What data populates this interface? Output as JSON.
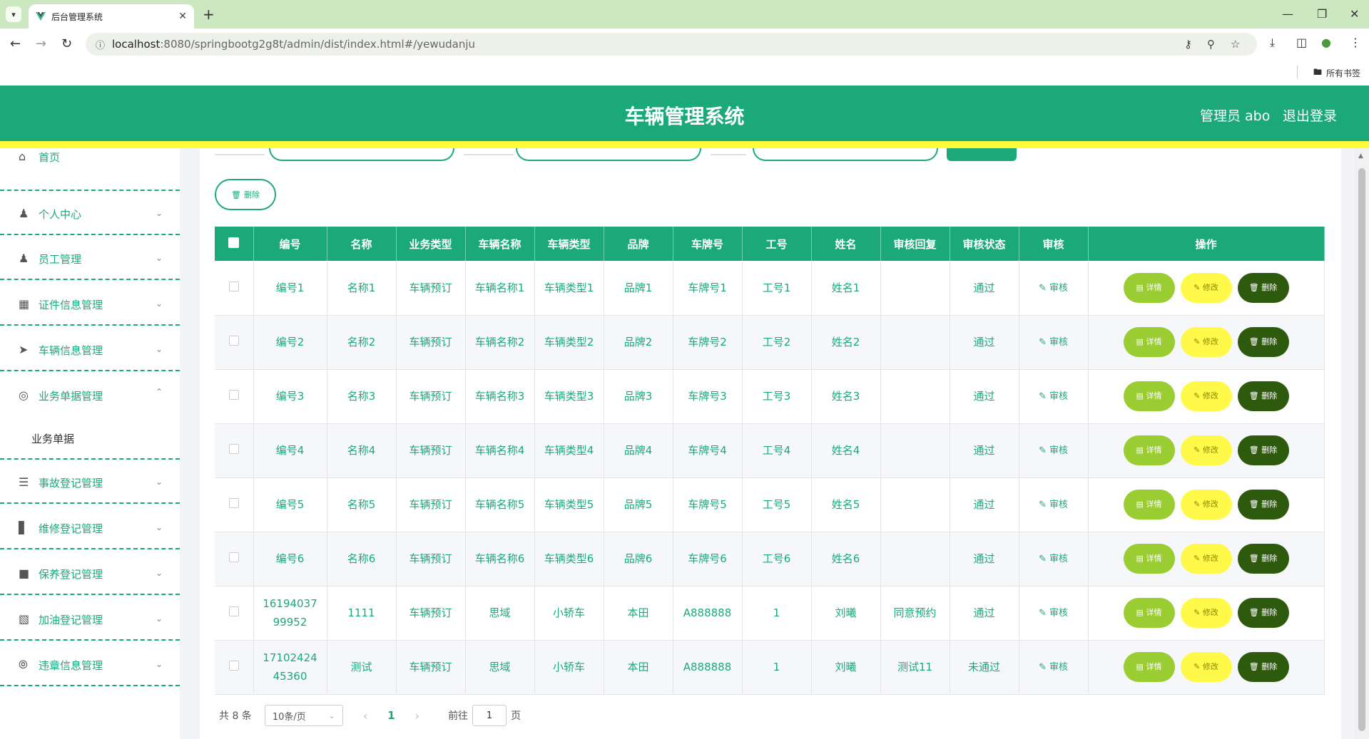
{
  "browser": {
    "tab_title": "后台管理系统",
    "url_host": "localhost",
    "url_rest": ":8080/springbootg2g8t/admin/dist/index.html#/yewudanju",
    "bookmarks_label": "所有书签"
  },
  "header": {
    "title": "车辆管理系统",
    "admin_label": "管理员 abo",
    "logout_label": "退出登录"
  },
  "sidebar": {
    "items": [
      {
        "label": "首页",
        "icon": "home-icon"
      },
      {
        "label": "个人中心",
        "icon": "user-icon"
      },
      {
        "label": "员工管理",
        "icon": "user-icon"
      },
      {
        "label": "证件信息管理",
        "icon": "grid-icon"
      },
      {
        "label": "车辆信息管理",
        "icon": "send-icon"
      },
      {
        "label": "业务单据管理",
        "icon": "circle-icon"
      },
      {
        "label": "事故登记管理",
        "icon": "list-icon"
      },
      {
        "label": "维修登记管理",
        "icon": "bar-chart-icon"
      },
      {
        "label": "保养登记管理",
        "icon": "brush-icon"
      },
      {
        "label": "加油登记管理",
        "icon": "calendar-icon"
      },
      {
        "label": "违章信息管理",
        "icon": "compass-icon"
      }
    ],
    "submenu_label": "业务单据"
  },
  "toolbar": {
    "delete_label": "删除"
  },
  "table": {
    "headers": [
      "编号",
      "名称",
      "业务类型",
      "车辆名称",
      "车辆类型",
      "品牌",
      "车牌号",
      "工号",
      "姓名",
      "审核回复",
      "审核状态",
      "审核",
      "操作"
    ],
    "audit_label": "审核",
    "detail_label": "详情",
    "edit_label": "修改",
    "delete_label": "删除",
    "rows": [
      {
        "c0": "编号1",
        "c1": "名称1",
        "c2": "车辆预订",
        "c3": "车辆名称1",
        "c4": "车辆类型1",
        "c5": "品牌1",
        "c6": "车牌号1",
        "c7": "工号1",
        "c8": "姓名1",
        "c9": "",
        "c10": "通过"
      },
      {
        "c0": "编号2",
        "c1": "名称2",
        "c2": "车辆预订",
        "c3": "车辆名称2",
        "c4": "车辆类型2",
        "c5": "品牌2",
        "c6": "车牌号2",
        "c7": "工号2",
        "c8": "姓名2",
        "c9": "",
        "c10": "通过"
      },
      {
        "c0": "编号3",
        "c1": "名称3",
        "c2": "车辆预订",
        "c3": "车辆名称3",
        "c4": "车辆类型3",
        "c5": "品牌3",
        "c6": "车牌号3",
        "c7": "工号3",
        "c8": "姓名3",
        "c9": "",
        "c10": "通过"
      },
      {
        "c0": "编号4",
        "c1": "名称4",
        "c2": "车辆预订",
        "c3": "车辆名称4",
        "c4": "车辆类型4",
        "c5": "品牌4",
        "c6": "车牌号4",
        "c7": "工号4",
        "c8": "姓名4",
        "c9": "",
        "c10": "通过"
      },
      {
        "c0": "编号5",
        "c1": "名称5",
        "c2": "车辆预订",
        "c3": "车辆名称5",
        "c4": "车辆类型5",
        "c5": "品牌5",
        "c6": "车牌号5",
        "c7": "工号5",
        "c8": "姓名5",
        "c9": "",
        "c10": "通过"
      },
      {
        "c0": "编号6",
        "c1": "名称6",
        "c2": "车辆预订",
        "c3": "车辆名称6",
        "c4": "车辆类型6",
        "c5": "品牌6",
        "c6": "车牌号6",
        "c7": "工号6",
        "c8": "姓名6",
        "c9": "",
        "c10": "通过"
      },
      {
        "c0": "1619403799952",
        "c1": "1111",
        "c2": "车辆预订",
        "c3": "思域",
        "c4": "小轿车",
        "c5": "本田",
        "c6": "A888888",
        "c7": "1",
        "c8": "刘曦",
        "c9": "同意预约",
        "c10": "通过"
      },
      {
        "c0": "1710242445360",
        "c1": "测试",
        "c2": "车辆预订",
        "c3": "思域",
        "c4": "小轿车",
        "c5": "本田",
        "c6": "A888888",
        "c7": "1",
        "c8": "刘曦",
        "c9": "测试11",
        "c10": "未通过"
      }
    ]
  },
  "pagination": {
    "total": "共 8 条",
    "page_size": "10条/页",
    "current_page": "1",
    "goto_label": "前往",
    "goto_value": "1",
    "page_suffix": "页"
  },
  "colors": {
    "primary": "#1ba97a",
    "accent_yellow": "#fffb3b",
    "detail_btn": "#9acd32",
    "edit_btn": "#fff94a",
    "delete_btn": "#2d5a0c"
  }
}
